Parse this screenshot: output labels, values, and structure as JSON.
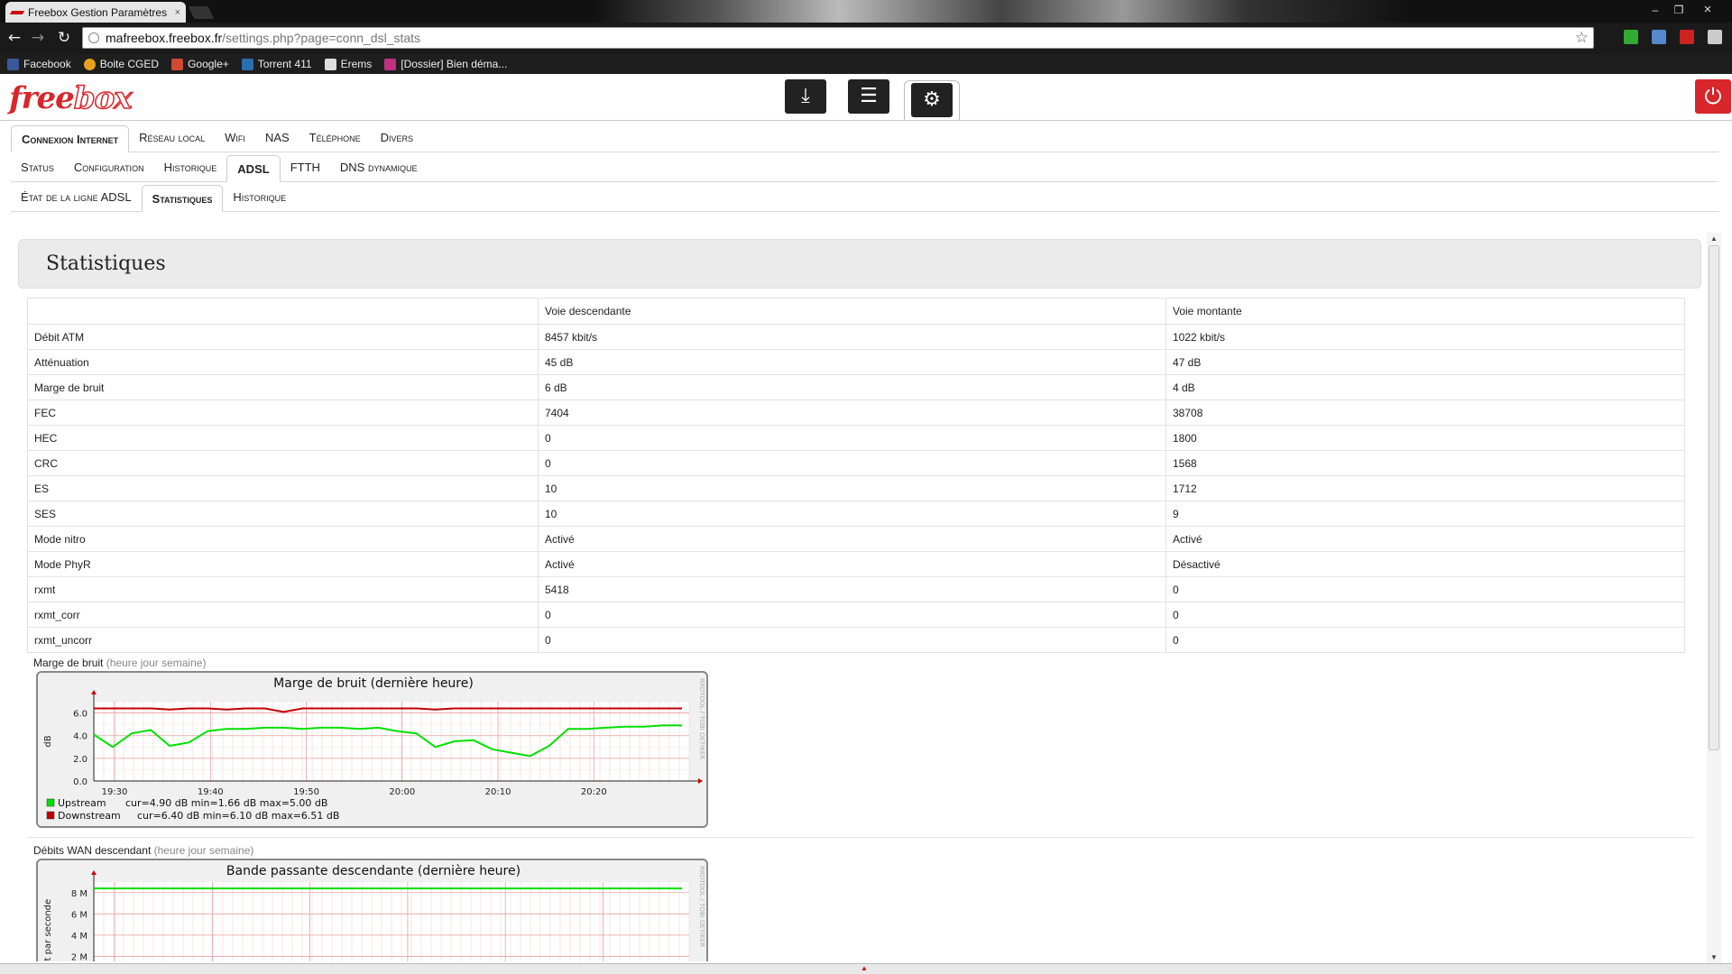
{
  "browser": {
    "tab_title": "Freebox Gestion Paramètres",
    "tab_close": "×",
    "url_host": "mafreebox.freebox.fr",
    "url_path": "/settings.php?page=conn_dsl_stats",
    "win_minimize": "–",
    "win_restore": "❐",
    "win_close": "×",
    "back": "←",
    "forward": "→",
    "reload": "↻",
    "star": "☆",
    "bookmarks": [
      {
        "label": "Facebook",
        "color": "#3b5998"
      },
      {
        "label": "Boite CGED",
        "color": "#e8a020"
      },
      {
        "label": "Google+",
        "color": "#d34836"
      },
      {
        "label": "Torrent 411",
        "color": "#2a6fb0"
      },
      {
        "label": "Erems",
        "color": "#dddddd"
      },
      {
        "label": "[Dossier] Bien déma...",
        "color": "#c03080"
      }
    ]
  },
  "header": {
    "logo_a": "free",
    "logo_b": "box",
    "icons": [
      "download-icon",
      "list-icon",
      "gear-icon"
    ],
    "power": "⏻",
    "brand_color": "#d8262b"
  },
  "tabs1": [
    "Connexion Internet",
    "Réseau local",
    "Wifi",
    "NAS",
    "Téléphone",
    "Divers"
  ],
  "tabs2": [
    "Status",
    "Configuration",
    "Historique",
    "ADSL",
    "FTTH",
    "DNS dynamique"
  ],
  "tabs3": [
    "État de la ligne ADSL",
    "Statistiques",
    "Historique"
  ],
  "page": {
    "title": "Statistiques"
  },
  "table": {
    "headers": [
      "",
      "Voie descendante",
      "Voie montante"
    ],
    "rows": [
      [
        "Débit ATM",
        "8457 kbit/s",
        "1022 kbit/s"
      ],
      [
        "Atténuation",
        "45 dB",
        "47 dB"
      ],
      [
        "Marge de bruit",
        "6 dB",
        "4 dB"
      ],
      [
        "FEC",
        "7404",
        "38708"
      ],
      [
        "HEC",
        "0",
        "1800"
      ],
      [
        "CRC",
        "0",
        "1568"
      ],
      [
        "ES",
        "10",
        "1712"
      ],
      [
        "SES",
        "10",
        "9"
      ],
      [
        "Mode nitro",
        "Activé",
        "Activé"
      ],
      [
        "Mode PhyR",
        "Activé",
        "Désactivé"
      ],
      [
        "rxmt",
        "5418",
        "0"
      ],
      [
        "rxmt_corr",
        "0",
        "0"
      ],
      [
        "rxmt_uncorr",
        "0",
        "0"
      ]
    ]
  },
  "graph1": {
    "label": "Marge de bruit",
    "links": "(heure jour semaine)",
    "title": "Marge de bruit (dernière heure)",
    "ylabel": "dB",
    "watermark": "RRDTOOL / TOBI OETIKER",
    "legend": [
      {
        "name": "Upstream",
        "stats": "cur=4.90  dB    min=1.66  dB    max=5.00  dB",
        "color": "#00e000"
      },
      {
        "name": "Downstream",
        "stats": "cur=6.40  dB    min=6.10  dB    max=6.51  dB",
        "color": "#c00000"
      }
    ]
  },
  "graph2": {
    "label": "Débits WAN descendant",
    "links": "(heure jour semaine)",
    "title": "Bande passante descendante (dernière heure)",
    "ylabel": "Bit par seconde",
    "watermark": "RRDTOOL / TOBI OETIKER"
  },
  "chart_data": [
    {
      "type": "line",
      "title": "Marge de bruit (dernière heure)",
      "ylabel": "dB",
      "ylim": [
        0,
        7
      ],
      "yticks": [
        "0.0",
        "2.0",
        "4.0",
        "6.0"
      ],
      "xticks": [
        "19:30",
        "19:40",
        "19:50",
        "20:00",
        "20:10",
        "20:20"
      ],
      "x": [
        "19:25",
        "19:27",
        "19:29",
        "19:31",
        "19:33",
        "19:35",
        "19:37",
        "19:39",
        "19:41",
        "19:43",
        "19:45",
        "19:47",
        "19:49",
        "19:51",
        "19:53",
        "19:55",
        "19:57",
        "19:59",
        "20:01",
        "20:03",
        "20:05",
        "20:07",
        "20:09",
        "20:11",
        "20:13",
        "20:15",
        "20:17",
        "20:19",
        "20:21",
        "20:23",
        "20:25",
        "20:27"
      ],
      "series": [
        {
          "name": "Upstream",
          "color": "#00e000",
          "values": [
            4.1,
            3.0,
            4.2,
            4.5,
            3.1,
            3.4,
            4.4,
            4.6,
            4.6,
            4.7,
            4.7,
            4.6,
            4.7,
            4.7,
            4.6,
            4.7,
            4.4,
            4.2,
            3.0,
            3.5,
            3.6,
            2.8,
            2.5,
            2.2,
            3.1,
            4.6,
            4.6,
            4.7,
            4.8,
            4.8,
            4.9,
            4.9
          ]
        },
        {
          "name": "Downstream",
          "color": "#c00000",
          "values": [
            6.4,
            6.4,
            6.4,
            6.4,
            6.3,
            6.4,
            6.4,
            6.3,
            6.4,
            6.4,
            6.1,
            6.4,
            6.4,
            6.4,
            6.4,
            6.4,
            6.4,
            6.4,
            6.3,
            6.4,
            6.4,
            6.4,
            6.4,
            6.4,
            6.4,
            6.4,
            6.4,
            6.4,
            6.4,
            6.4,
            6.4,
            6.4
          ]
        }
      ]
    },
    {
      "type": "line",
      "title": "Bande passante descendante (dernière heure)",
      "ylabel": "Bit par seconde",
      "yticks": [
        "2 M",
        "4 M",
        "6 M",
        "8 M"
      ],
      "ylim": [
        0,
        9
      ],
      "series": [
        {
          "color": "#00e000",
          "values": [
            8.4,
            8.4
          ]
        }
      ]
    }
  ]
}
